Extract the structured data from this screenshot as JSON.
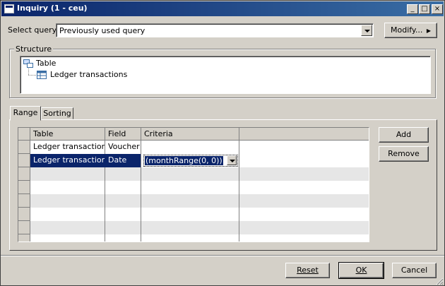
{
  "window": {
    "title": "Inquiry (1 - ceu)"
  },
  "caption_buttons": {
    "minimize": "_",
    "maximize": "□",
    "close": "×"
  },
  "query": {
    "label": "Select query:",
    "value": "Previously used query",
    "modify_label": "Modify..."
  },
  "structure": {
    "legend": "Structure",
    "root": "Table",
    "child": "Ledger transactions"
  },
  "tabs": [
    {
      "label": "Range",
      "active": true
    },
    {
      "label": "Sorting",
      "active": false
    }
  ],
  "grid": {
    "columns": [
      "Table",
      "Field",
      "Criteria"
    ],
    "rows": [
      {
        "table": "Ledger transactions",
        "field": "Voucher",
        "criteria": ""
      },
      {
        "table": "Ledger transactions",
        "field": "Date",
        "criteria": "(monthRange(0, 0))"
      }
    ],
    "selected_row": 1
  },
  "side_buttons": {
    "add": "Add",
    "remove": "Remove"
  },
  "footer": {
    "reset": "Reset",
    "ok": "OK",
    "cancel": "Cancel"
  },
  "colors": {
    "titlebar": "#0a246a",
    "selection": "#0a246a",
    "face": "#d4d0c8"
  }
}
